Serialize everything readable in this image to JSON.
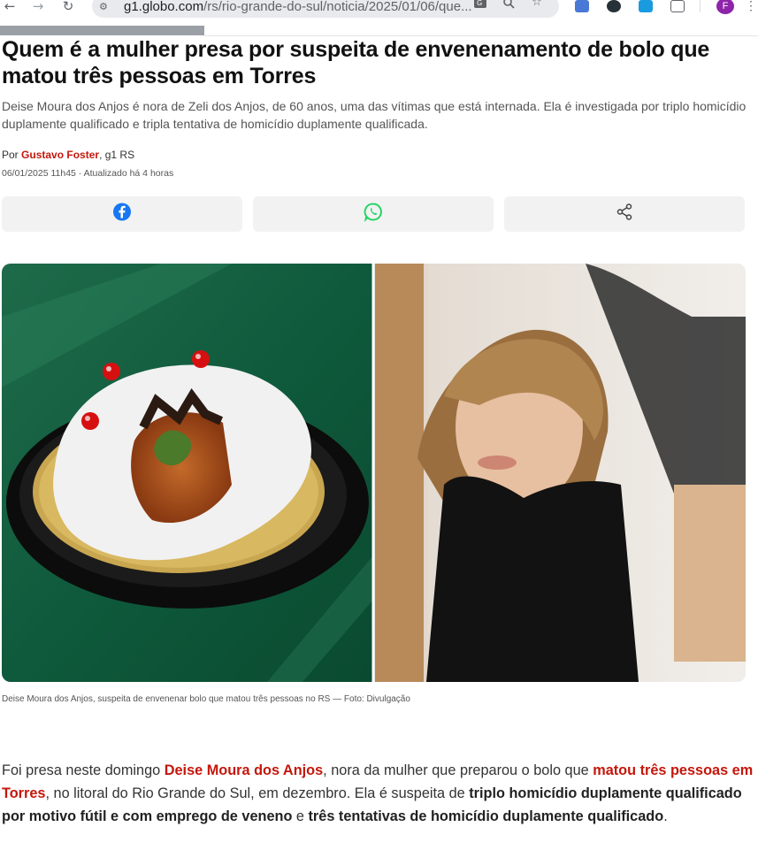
{
  "browser": {
    "url_host": "g1.globo.com",
    "url_path": "/rs/rio-grande-do-sul/noticia/2025/01/06/que...",
    "profile_initial": "F",
    "icons": [
      "back-arrow-icon",
      "forward-arrow-icon",
      "reload-icon",
      "site-info-icon",
      "translate-icon",
      "zoom-icon",
      "bookmark-star-icon",
      "extension-icons",
      "extensions-puzzle-icon",
      "menu-icon"
    ]
  },
  "article": {
    "headline": "Quem é a mulher presa por suspeita de envenenamento de bolo que matou três pessoas em Torres",
    "subhead": "Deise Moura dos Anjos é nora de Zeli dos Anjos, de 60 anos, uma das vítimas que está internada. Ela é investigada por triplo homicídio duplamente qualificado e tripla tentativa de homicídio duplamente qualificada.",
    "byline_prefix": "Por",
    "author": "Gustavo Foster",
    "outlet": ", g1 RS",
    "dateline": "06/01/2025 11h45 · Atualizado há 4 horas",
    "share": [
      "facebook-icon",
      "whatsapp-icon",
      "share-icon"
    ],
    "caption": "Deise Moura dos Anjos, suspeita de envenenar bolo que matou três pessoas no RS — Foto: Divulgação",
    "body": {
      "p1": "Foi presa neste domingo ",
      "p1_link1": "Deise Moura dos Anjos",
      "p2": ", nora da mulher que preparou o bolo que ",
      "p2_link2": "matou três pessoas em Torres",
      "p3": ", no litoral do Rio Grande do Sul, em dezembro. Ela é suspeita de ",
      "p3_bold1": "triplo homicídio duplamente qualificado por motivo fútil e com emprego de veneno",
      "p4": " e ",
      "p4_bold2": "três tentativas de homicídio duplamente qualificado",
      "p5": "."
    }
  },
  "colors": {
    "brand_red": "#c4170c",
    "facebook": "#1877f2",
    "whatsapp": "#25d366"
  }
}
